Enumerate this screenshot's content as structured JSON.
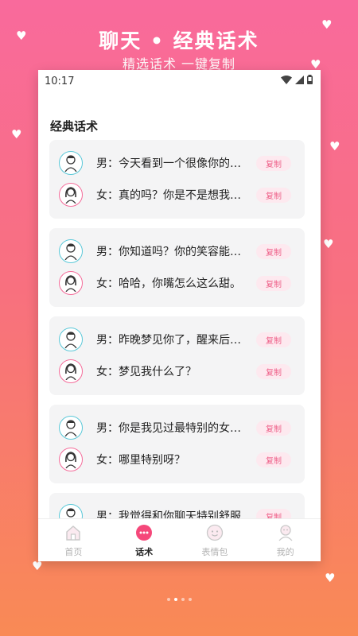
{
  "hero": {
    "title": "聊天 • 经典话术",
    "subtitle": "精选话术 一键复制"
  },
  "statusbar": {
    "time": "10:17",
    "icons": [
      "wifi-icon",
      "signal-icon",
      "battery-icon"
    ]
  },
  "section_title": "经典话术",
  "copy_label": "复制",
  "dialogues": [
    {
      "male": "男：今天看到一个很像你的背影...",
      "female": "女：真的吗？你是不是想我了？"
    },
    {
      "male": "男：你知道吗？你的笑容能照亮...",
      "female": "女：哈哈，你嘴怎么这么甜。"
    },
    {
      "male": "男：昨晚梦见你了，醒来后特别...",
      "female": "女：梦见我什么了？"
    },
    {
      "male": "男：你是我见过最特别的女孩。",
      "female": "女：哪里特别呀？"
    },
    {
      "male": "男：我觉得和你聊天特别舒服",
      "female": ""
    }
  ],
  "tabs": [
    {
      "label": "首页",
      "icon": "home-icon",
      "active": false
    },
    {
      "label": "话术",
      "icon": "chat-icon",
      "active": true
    },
    {
      "label": "表情包",
      "icon": "emoji-icon",
      "active": false
    },
    {
      "label": "我的",
      "icon": "profile-icon",
      "active": false
    }
  ],
  "colors": {
    "gradient_top": "#f96a9c",
    "gradient_bottom": "#f98a55",
    "accent": "#ee5f88",
    "male_ring": "#5ac8d8",
    "female_ring": "#f46c9a"
  },
  "pager": {
    "count": 4,
    "active_index": 1
  }
}
